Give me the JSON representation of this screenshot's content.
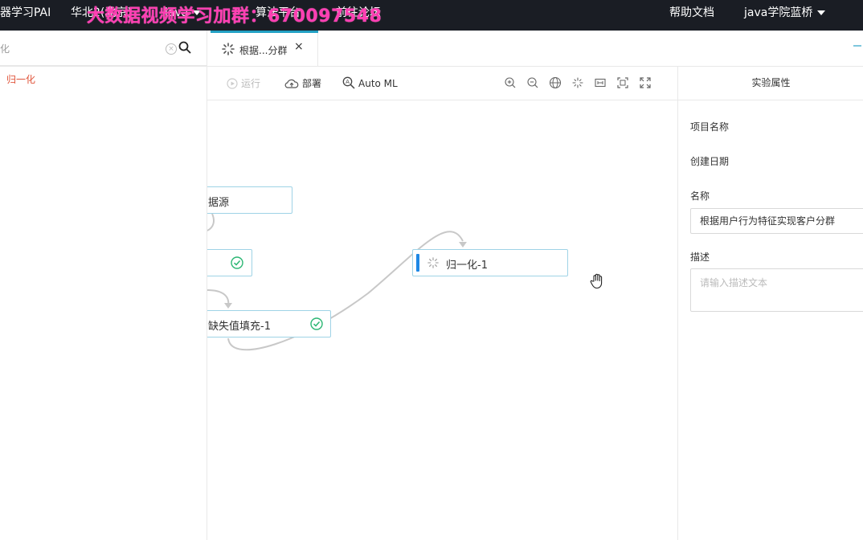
{
  "topbar": {
    "product": "器学习PAI",
    "region": "华北2(北京)",
    "workspace": "java",
    "nav_algo": "算法平台",
    "nav_forum": "前往论坛",
    "help": "帮助文档",
    "user": "java学院蓝桥"
  },
  "watermark": "大数据视频学习加群：670097548",
  "search": {
    "value": "化"
  },
  "sidebar": {
    "items": [
      {
        "label": "归一化"
      }
    ]
  },
  "tab": {
    "label": "根据...分群",
    "close": "×"
  },
  "toolbar": {
    "run": "运行",
    "deploy": "部署",
    "automl": "Auto ML"
  },
  "nodes": {
    "datasource": "据源",
    "split": "",
    "fill": "缺失值填充-1",
    "normalize": "归一化-1"
  },
  "props": {
    "title": "实验属性",
    "project_label": "项目名称",
    "created_label": "创建日期",
    "name_label": "名称",
    "name_value": "根据用户行为特征实现客户分群",
    "desc_label": "描述",
    "desc_placeholder": "请输入描述文本"
  },
  "colors": {
    "accent": "#23a1c4",
    "success": "#2bb673",
    "running": "#1e88e5",
    "watermark": "#ff3fb3",
    "topbar": "#1a1d24"
  }
}
